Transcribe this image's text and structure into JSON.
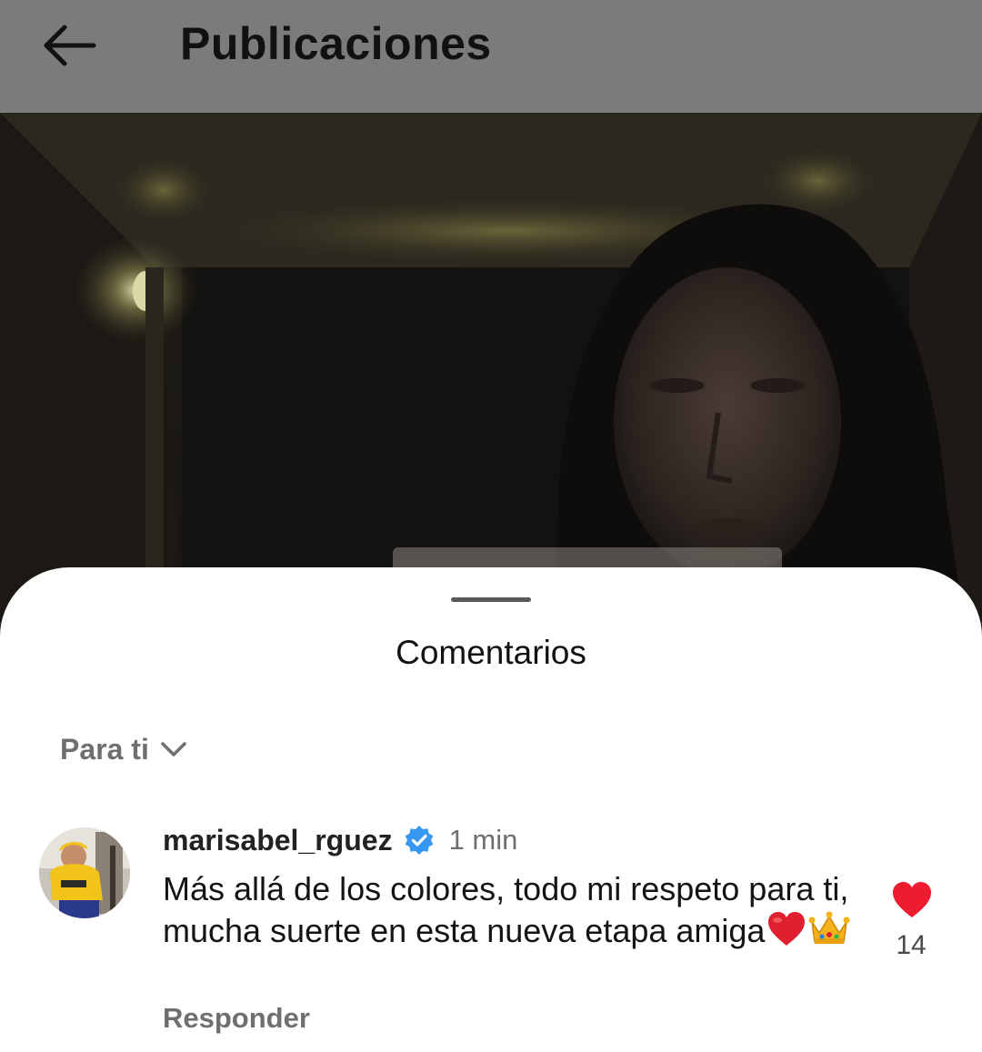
{
  "header": {
    "title": "Publicaciones",
    "back_icon": "arrow-left-icon"
  },
  "post": {
    "image_icon": "post-photo"
  },
  "comments_sheet": {
    "title": "Comentarios",
    "sort_label": "Para ti",
    "sort_icon": "chevron-down-icon"
  },
  "comment": {
    "username": "marisabel_rguez",
    "verified_icon": "verified-badge-icon",
    "time": "1 min",
    "text": "Más allá de los colores, todo mi respeto para ti, mucha suerte en esta nueva etapa amiga",
    "emojis": [
      "❤️",
      "👑"
    ],
    "reply_label": "Responder",
    "like_icon": "heart-icon",
    "like_count": "14",
    "liked": true
  },
  "colors": {
    "accent_like": "#ed1c2e",
    "verified": "#3897f0",
    "header_dimmed": "#7b7b7b"
  }
}
